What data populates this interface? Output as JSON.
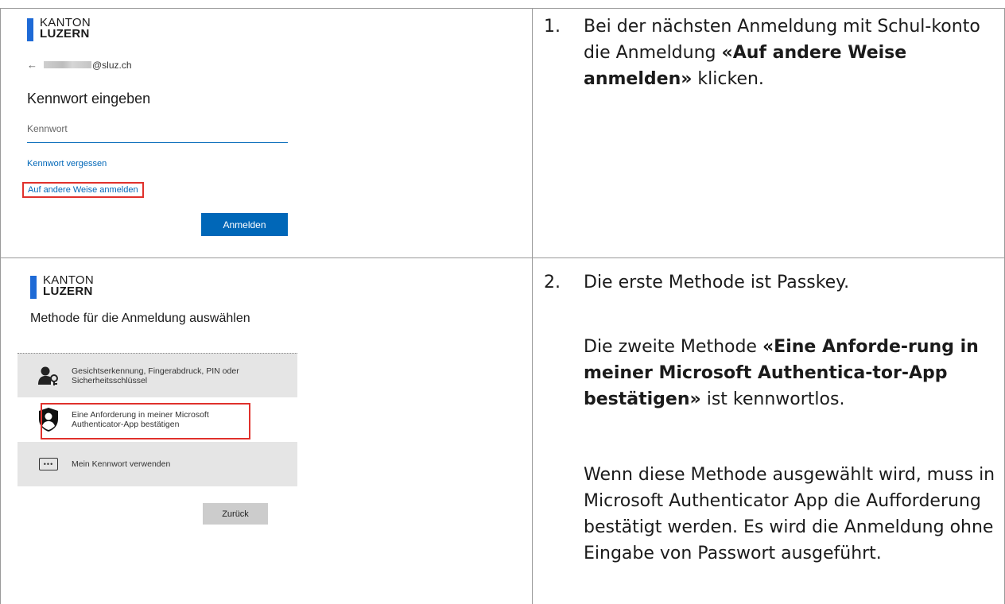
{
  "step1": {
    "number": "1.",
    "text_before": "Bei der nächsten Anmeldung mit Schul-konto die Anmeldung ",
    "text_bold": "«Auf andere Weise anmelden»",
    "text_after": " klicken.",
    "login": {
      "logo_line1": "KANTON",
      "logo_line2": "LUZERN",
      "back_arrow": "←",
      "email_domain": "@sluz.ch",
      "heading": "Kennwort eingeben",
      "password_placeholder": "Kennwort",
      "forgot_link": "Kennwort vergessen",
      "other_way_link": "Auf andere Weise anmelden",
      "signin_button": "Anmelden"
    }
  },
  "step2": {
    "number": "2.",
    "para1": "Die erste Methode ist Passkey.",
    "para2_before": "Die zweite Methode ",
    "para2_bold": "«Eine Anforde-rung in meiner Microsoft Authentica-tor-App bestätigen»",
    "para2_after": " ist kennwortlos.",
    "para3": "Wenn diese Methode ausgewählt wird, muss in Microsoft Authenticator App die Aufforderung bestätigt werden. Es wird die Anmeldung ohne Eingabe von Passwort ausgeführt.",
    "method": {
      "logo_line1": "KANTON",
      "logo_line2": "LUZERN",
      "heading": "Methode für die Anmeldung auswählen",
      "option1": "Gesichtserkennung, Fingerabdruck, PIN oder Sicherheitsschlüssel",
      "option2": "Eine Anforderung in meiner Microsoft Authenticator-App bestätigen",
      "option3": "Mein Kennwort verwenden",
      "back_button": "Zurück"
    }
  },
  "colors": {
    "accent": "#0067b8",
    "highlight": "#e0312c",
    "logo": "#1e6ad6"
  }
}
